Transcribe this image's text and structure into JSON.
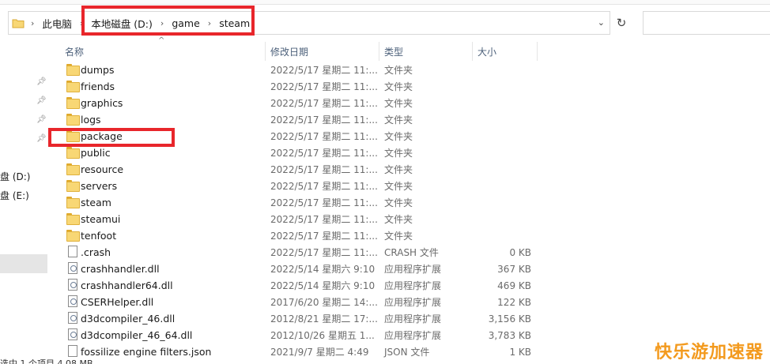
{
  "address_bar": {
    "breadcrumbs": [
      "此电脑",
      "本地磁盘 (D:)",
      "game",
      "steam"
    ]
  },
  "columns": {
    "name": "名称",
    "date": "修改日期",
    "type": "类型",
    "size": "大小"
  },
  "nav": {
    "drives": [
      "盘 (D:)",
      "盘 (E:)"
    ],
    "status": "选中 1 个项目 4.08 MB"
  },
  "files": [
    {
      "name": "dumps",
      "date": "2022/5/17 星期二 11:...",
      "type": "文件夹",
      "size": "",
      "kind": "folder"
    },
    {
      "name": "friends",
      "date": "2022/5/17 星期二 11:...",
      "type": "文件夹",
      "size": "",
      "kind": "folder"
    },
    {
      "name": "graphics",
      "date": "2022/5/17 星期二 11:...",
      "type": "文件夹",
      "size": "",
      "kind": "folder"
    },
    {
      "name": "logs",
      "date": "2022/5/17 星期二 11:...",
      "type": "文件夹",
      "size": "",
      "kind": "folder"
    },
    {
      "name": "package",
      "date": "2022/5/17 星期二 11:...",
      "type": "文件夹",
      "size": "",
      "kind": "folder"
    },
    {
      "name": "public",
      "date": "2022/5/17 星期二 11:...",
      "type": "文件夹",
      "size": "",
      "kind": "folder"
    },
    {
      "name": "resource",
      "date": "2022/5/17 星期二 11:...",
      "type": "文件夹",
      "size": "",
      "kind": "folder"
    },
    {
      "name": "servers",
      "date": "2022/5/17 星期二 11:...",
      "type": "文件夹",
      "size": "",
      "kind": "folder"
    },
    {
      "name": "steam",
      "date": "2022/5/17 星期二 11:...",
      "type": "文件夹",
      "size": "",
      "kind": "folder"
    },
    {
      "name": "steamui",
      "date": "2022/5/17 星期二 11:...",
      "type": "文件夹",
      "size": "",
      "kind": "folder"
    },
    {
      "name": "tenfoot",
      "date": "2022/5/17 星期二 11:...",
      "type": "文件夹",
      "size": "",
      "kind": "folder"
    },
    {
      "name": ".crash",
      "date": "2022/5/17 星期二 11:...",
      "type": "CRASH 文件",
      "size": "0 KB",
      "kind": "file"
    },
    {
      "name": "crashhandler.dll",
      "date": "2022/5/14 星期六 9:10",
      "type": "应用程序扩展",
      "size": "367 KB",
      "kind": "dll"
    },
    {
      "name": "crashhandler64.dll",
      "date": "2022/5/14 星期六 9:10",
      "type": "应用程序扩展",
      "size": "469 KB",
      "kind": "dll"
    },
    {
      "name": "CSERHelper.dll",
      "date": "2017/6/20 星期二 14:...",
      "type": "应用程序扩展",
      "size": "122 KB",
      "kind": "dll"
    },
    {
      "name": "d3dcompiler_46.dll",
      "date": "2012/8/21 星期二 17:...",
      "type": "应用程序扩展",
      "size": "3,156 KB",
      "kind": "dll"
    },
    {
      "name": "d3dcompiler_46_64.dll",
      "date": "2012/10/26 星期五 1...",
      "type": "应用程序扩展",
      "size": "3,783 KB",
      "kind": "dll"
    },
    {
      "name": "fossilize engine filters.json",
      "date": "2021/9/7 星期二 4:49",
      "type": "JSON 文件",
      "size": "1 KB",
      "kind": "file"
    }
  ],
  "watermark": "快乐游加速器",
  "colors": {
    "highlight": "#e8262b",
    "watermark": "#f39a1e",
    "folder": "#f8d775"
  }
}
